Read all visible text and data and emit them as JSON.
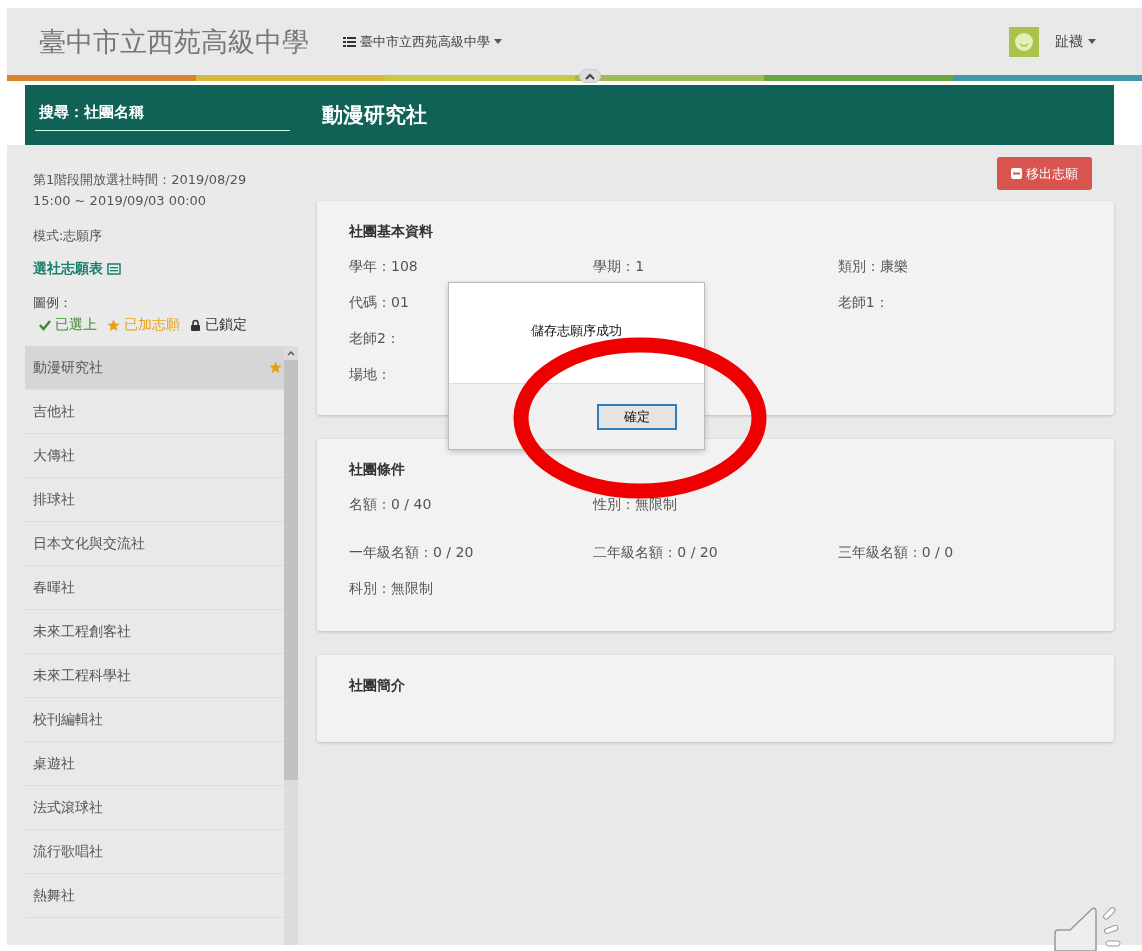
{
  "header": {
    "title": "臺中市立西苑高級中學",
    "school_menu": "臺中市立西苑高級中學",
    "user": "趾襪"
  },
  "search": {
    "placeholder": "搜尋：社團名稱"
  },
  "club_title": "動漫研究社",
  "sidebar": {
    "period": "第1階段開放選社時間：2019/08/29 15:00 ~ 2019/09/03 00:00",
    "mode": "模式:志願序",
    "wishlist_link": "選社志願表",
    "legend_title": "圖例：",
    "legend": [
      {
        "kind": "check",
        "label": "已選上",
        "color": "#3c8d2f"
      },
      {
        "kind": "star",
        "label": "已加志願",
        "color": "#e6a117"
      },
      {
        "kind": "lock",
        "label": "已鎖定",
        "color": "#333333"
      }
    ],
    "items": [
      {
        "name": "動漫研究社",
        "selected": true,
        "wished": true
      },
      {
        "name": "吉他社",
        "selected": false,
        "wished": false
      },
      {
        "name": "大傳社",
        "selected": false,
        "wished": false
      },
      {
        "name": "排球社",
        "selected": false,
        "wished": false
      },
      {
        "name": "日本文化與交流社",
        "selected": false,
        "wished": false
      },
      {
        "name": "春暉社",
        "selected": false,
        "wished": false
      },
      {
        "name": "未來工程創客社",
        "selected": false,
        "wished": false
      },
      {
        "name": "未來工程科學社",
        "selected": false,
        "wished": false
      },
      {
        "name": "校刊編輯社",
        "selected": false,
        "wished": false
      },
      {
        "name": "桌遊社",
        "selected": false,
        "wished": false
      },
      {
        "name": "法式滾球社",
        "selected": false,
        "wished": false
      },
      {
        "name": "流行歌唱社",
        "selected": false,
        "wished": false
      },
      {
        "name": "熱舞社",
        "selected": false,
        "wished": false
      }
    ]
  },
  "remove_button": "移出志願",
  "cards": [
    {
      "title": "社團基本資料",
      "rows": [
        [
          {
            "label": "學年：",
            "value": "108"
          },
          {
            "label": "學期：",
            "value": "1"
          },
          {
            "label": "類別：",
            "value": "康樂"
          }
        ],
        [
          {
            "label": "代碼：",
            "value": "01"
          },
          null,
          {
            "label": "老師1："
          }
        ],
        [
          {
            "label": "老師2："
          }
        ],
        [
          {
            "label": "場地："
          }
        ]
      ]
    },
    {
      "title": "社團條件",
      "rows": [
        [
          {
            "label": "名額：",
            "value": "0 / 40"
          },
          {
            "label": "性別：",
            "value": "無限制"
          }
        ],
        [
          {
            "label": "一年級名額：",
            "value": "0 / 20"
          },
          {
            "label": "二年級名額：",
            "value": "0 / 20"
          },
          {
            "label": "三年級名額：",
            "value": "0 / 0"
          }
        ],
        [
          {
            "label": "科別：",
            "value": "無限制"
          }
        ]
      ]
    },
    {
      "title": "社團簡介"
    }
  ],
  "dialog": {
    "message": "儲存志願序成功",
    "ok": "確定"
  }
}
